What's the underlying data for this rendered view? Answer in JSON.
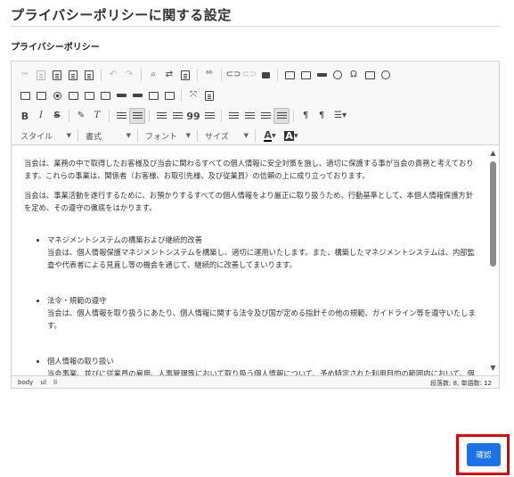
{
  "page": {
    "title": "プライバシーポリシーに関する設定"
  },
  "field": {
    "label": "プライバシーポリシー"
  },
  "toolbar": {
    "style_combo": "スタイル",
    "format_combo": "書式",
    "font_combo": "フォント",
    "size_combo": "サイズ",
    "text_color_glyph": "A",
    "bg_color_glyph": "A",
    "bold_glyph": "B",
    "italic_glyph": "I",
    "strike_glyph": "S",
    "remove_format_glyph": "T",
    "blockquote_glyph": "99",
    "omega_glyph": "Ω",
    "paragraph_glyph": "¶"
  },
  "editor_content": {
    "paragraphs": [
      "当会は、業務の中で取得したお客様及び当会に関わるすべての個人情報に安全対策を施し、適切に保護する事が当会の責務と考えております。これらの事業は、関係者（お客様、お取引先様、及び従業員）の信頼の上に成り立っております。",
      "当会は、事業活動を遂行するために、お預かりするすべての個人情報をより厳正に取り扱うため、行動基準として、本個人情報保護方針を定め、その遵守の徹底をはかります。"
    ],
    "items": [
      {
        "title": "マネジメントシステムの構築および継続的改善",
        "body": "当会は、個人情報保護マネジメントシステムを構築し、適切に運用いたします。また、構築したマネジメントシステムは、内部監査や代表者による見直し等の機会を通じて、継続的に改善してまいります。"
      },
      {
        "title": "法令・規範の遵守",
        "body": "当会は、個人情報を取り扱うにあたり、個人情報に関する法令及び国が定める指針その他の規範、ガイドライン等を遵守いたします。"
      },
      {
        "title": "個人情報の取り扱い",
        "body": "当会事業、並びに従業員の雇用、人事管理等において取り扱う個人情報について、予め特定された利用目的の範囲内において、個人情報の適切な取得、利用および提供を行い、利用目的の達成に必要な範囲を超える個人情報の取り扱い目"
      }
    ]
  },
  "statusbar": {
    "path": [
      "body",
      "ul",
      "li"
    ],
    "count": "段落数: 8, 単語数: 12"
  },
  "actions": {
    "confirm_label": "確認"
  },
  "colors": {
    "accent": "#1a73e8",
    "highlight": "#e10000"
  }
}
